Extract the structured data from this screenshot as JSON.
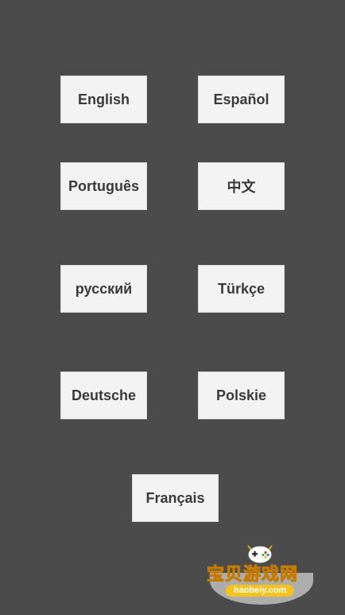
{
  "languages": [
    {
      "id": "english",
      "label": "English"
    },
    {
      "id": "espanol",
      "label": "Español"
    },
    {
      "id": "portugues",
      "label": "Português"
    },
    {
      "id": "chinese",
      "label": "中文"
    },
    {
      "id": "russian",
      "label": "русский"
    },
    {
      "id": "turkce",
      "label": "Türkçe"
    },
    {
      "id": "deutsche",
      "label": "Deutsche"
    },
    {
      "id": "polskie",
      "label": "Polskie"
    },
    {
      "id": "francais",
      "label": "Français"
    }
  ],
  "watermark": {
    "title": "宝贝游戏网",
    "url": "baobeiy.com"
  },
  "colors": {
    "background": "#4b4b4b",
    "button_bg": "#f3f3f3",
    "button_text": "#3a3a3a",
    "watermark_yellow": "#f6c21c"
  }
}
